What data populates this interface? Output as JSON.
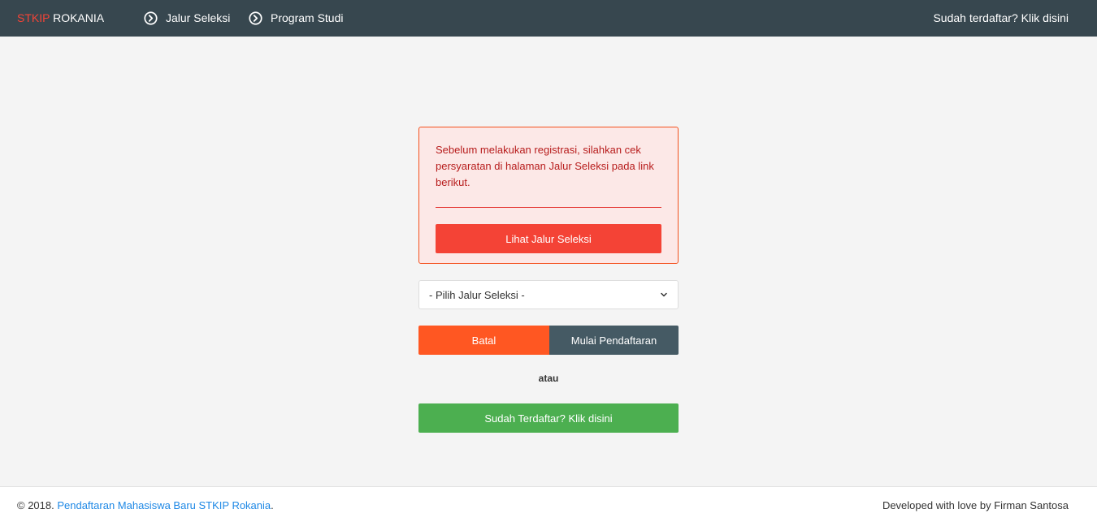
{
  "navbar": {
    "brand_part1": "STKIP",
    "brand_part2": " ROKANIA",
    "items": [
      {
        "label": "Jalur Seleksi",
        "icon": "chevron-circle-right-icon"
      },
      {
        "label": "Program Studi",
        "icon": "chevron-circle-right-icon"
      }
    ],
    "right_link": "Sudah terdaftar? Klik disini"
  },
  "alert": {
    "text": "Sebelum melakukan registrasi, silahkan cek persyaratan di halaman Jalur Seleksi pada link berikut.",
    "button_label": "Lihat Jalur Seleksi"
  },
  "form": {
    "select_value": "- Pilih Jalur Seleksi -",
    "cancel_label": "Batal",
    "start_label": "Mulai Pendaftaran",
    "or_label": "atau",
    "registered_label": "Sudah Terdaftar? Klik disini"
  },
  "footer": {
    "copyright_prefix": "© 2018. ",
    "link_text": "Pendaftaran Mahasiswa Baru STKIP Rokania",
    "copyright_suffix": ".",
    "right_text": "Developed with love by Firman Santosa"
  },
  "colors": {
    "navbar": "#37474f",
    "brand_accent": "#f44336",
    "alert_bg": "#fce8e7",
    "alert_button": "#f44336",
    "cancel": "#ff5722",
    "start": "#455a64",
    "registered": "#4caf50",
    "link": "#1e88e5"
  }
}
